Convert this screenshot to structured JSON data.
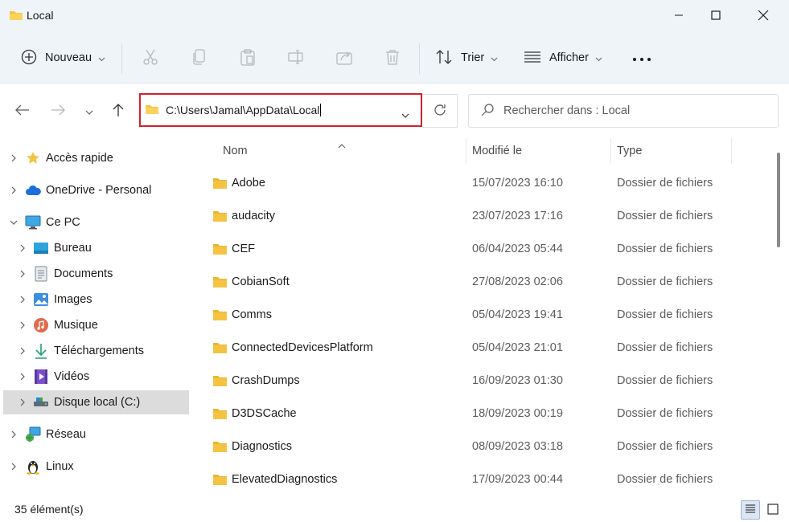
{
  "window": {
    "title": "Local",
    "minimize_icon": "minimize-icon",
    "maximize_icon": "maximize-icon",
    "close_icon": "close-icon"
  },
  "toolbar": {
    "new_label": "Nouveau",
    "sort_label": "Trier",
    "view_label": "Afficher",
    "more_icon": "more-icon"
  },
  "address": {
    "path": "C:\\Users\\Jamal\\AppData\\Local"
  },
  "search": {
    "placeholder": "Rechercher dans : Local"
  },
  "sidebar": {
    "items": [
      {
        "label": "Accès rapide",
        "icon": "star-icon"
      },
      {
        "label": "OneDrive - Personal",
        "icon": "cloud-icon"
      },
      {
        "label": "Ce PC",
        "icon": "pc-icon"
      },
      {
        "label": "Bureau",
        "icon": "desktop-icon"
      },
      {
        "label": "Documents",
        "icon": "documents-icon"
      },
      {
        "label": "Images",
        "icon": "images-icon"
      },
      {
        "label": "Musique",
        "icon": "music-icon"
      },
      {
        "label": "Téléchargements",
        "icon": "download-icon"
      },
      {
        "label": "Vidéos",
        "icon": "videos-icon"
      },
      {
        "label": "Disque local (C:)",
        "icon": "drive-icon"
      },
      {
        "label": "Réseau",
        "icon": "network-icon"
      },
      {
        "label": "Linux",
        "icon": "linux-icon"
      }
    ]
  },
  "columns": {
    "name": "Nom",
    "modified": "Modifié le",
    "type": "Type"
  },
  "files": [
    {
      "name": "Adobe",
      "date": "15/07/2023 16:10",
      "type": "Dossier de fichiers"
    },
    {
      "name": "audacity",
      "date": "23/07/2023 17:16",
      "type": "Dossier de fichiers"
    },
    {
      "name": "CEF",
      "date": "06/04/2023 05:44",
      "type": "Dossier de fichiers"
    },
    {
      "name": "CobianSoft",
      "date": "27/08/2023 02:06",
      "type": "Dossier de fichiers"
    },
    {
      "name": "Comms",
      "date": "05/04/2023 19:41",
      "type": "Dossier de fichiers"
    },
    {
      "name": "ConnectedDevicesPlatform",
      "date": "05/04/2023 21:01",
      "type": "Dossier de fichiers"
    },
    {
      "name": "CrashDumps",
      "date": "16/09/2023 01:30",
      "type": "Dossier de fichiers"
    },
    {
      "name": "D3DSCache",
      "date": "18/09/2023 00:19",
      "type": "Dossier de fichiers"
    },
    {
      "name": "Diagnostics",
      "date": "08/09/2023 03:18",
      "type": "Dossier de fichiers"
    },
    {
      "name": "ElevatedDiagnostics",
      "date": "17/09/2023 00:44",
      "type": "Dossier de fichiers"
    }
  ],
  "status": {
    "count": "35 élément(s)"
  },
  "colors": {
    "accent_red": "#d4202a",
    "folder_yellow": "#f5c342",
    "titlebar_bg": "#eff4f9"
  }
}
